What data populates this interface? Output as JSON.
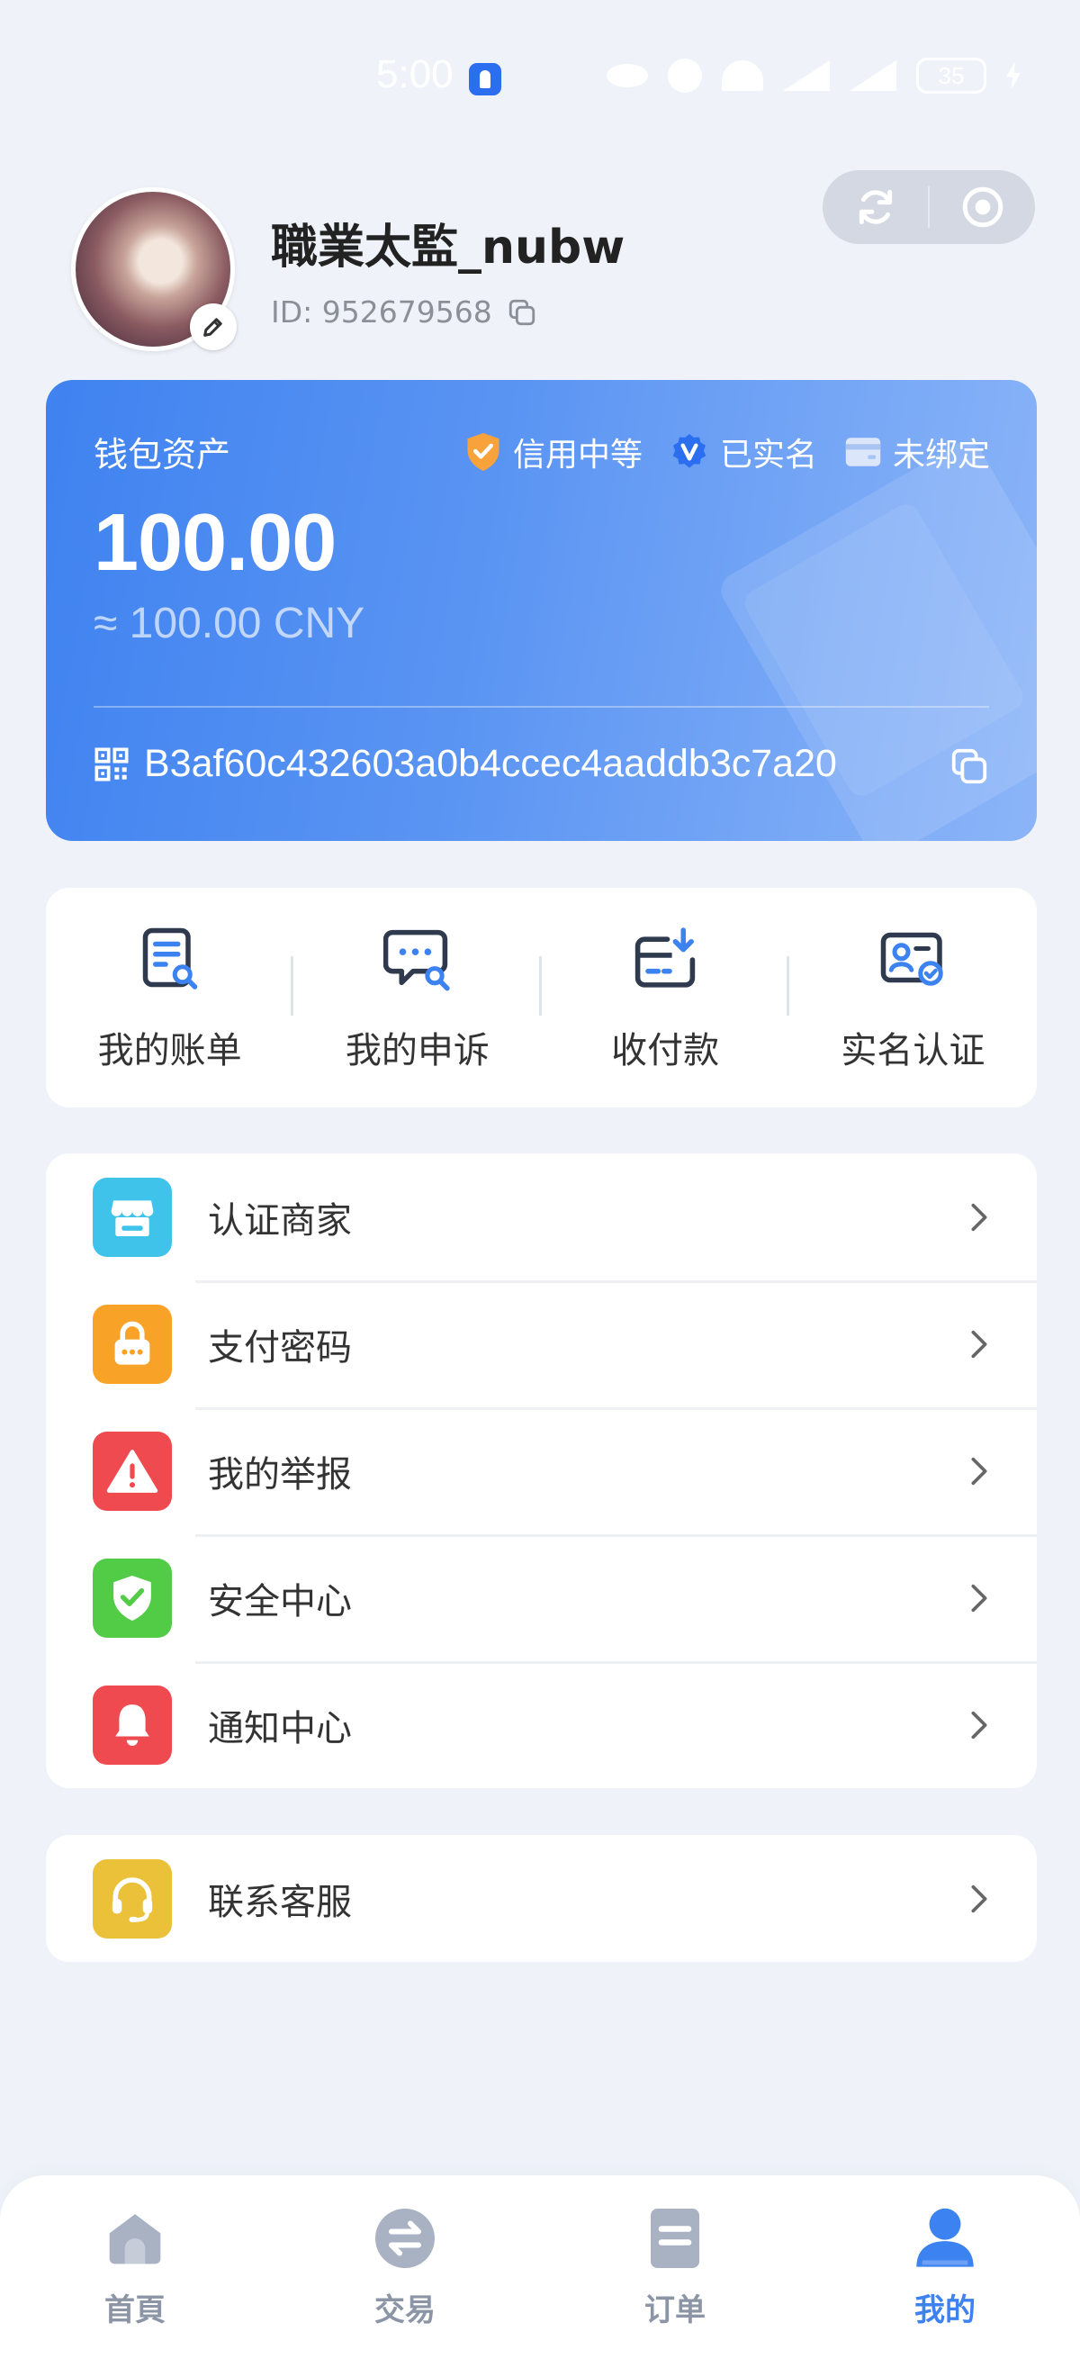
{
  "status_bar": {
    "time": "5:00",
    "battery": "35",
    "icons": [
      "notification-app-icon",
      "eye-icon",
      "alarm-icon",
      "wifi-icon",
      "5g-signal-icon",
      "4g-signal-icon",
      "battery-icon",
      "charging-icon"
    ]
  },
  "profile": {
    "username": "職業太監_nubw",
    "id_text": "ID: 952679568",
    "actions": [
      "refresh-icon",
      "record-icon"
    ]
  },
  "wallet": {
    "title": "钱包资产",
    "badges": [
      {
        "label": "信用中等",
        "icon": "shield-icon",
        "color": "#f7a23b"
      },
      {
        "label": "已实名",
        "icon": "verified-v-icon",
        "color": "#2b6ff0"
      },
      {
        "label": "未绑定",
        "icon": "card-icon",
        "color": "#dbe6fb"
      }
    ],
    "amount": "100.00",
    "sub_amount": "≈ 100.00 CNY",
    "address": "B3af60c432603a0b4ccec4aaddb3c7a20",
    "colors": {
      "start": "#3f82f0",
      "end": "#8cb5f8"
    }
  },
  "quick_actions": [
    {
      "label": "我的账单",
      "icon": "bill-search-icon"
    },
    {
      "label": "我的申诉",
      "icon": "appeal-chat-icon"
    },
    {
      "label": "收付款",
      "icon": "payment-card-icon"
    },
    {
      "label": "实名认证",
      "icon": "id-verify-icon"
    }
  ],
  "menu": [
    {
      "label": "认证商家",
      "icon": "store-icon",
      "color": "#3fc3ea"
    },
    {
      "label": "支付密码",
      "icon": "lock-icon",
      "color": "#f8a227"
    },
    {
      "label": "我的举报",
      "icon": "warning-icon",
      "color": "#ef4a4f"
    },
    {
      "label": "安全中心",
      "icon": "shield-check-icon",
      "color": "#52cc46"
    },
    {
      "label": "通知中心",
      "icon": "bell-icon",
      "color": "#ef4a4f"
    }
  ],
  "menu2": [
    {
      "label": "联系客服",
      "icon": "headset-icon",
      "color": "#ebc13a"
    }
  ],
  "bottom_nav": [
    {
      "label": "首頁",
      "icon": "home-icon",
      "active": false
    },
    {
      "label": "交易",
      "icon": "exchange-icon",
      "active": false
    },
    {
      "label": "订单",
      "icon": "orders-icon",
      "active": false
    },
    {
      "label": "我的",
      "icon": "user-icon",
      "active": true
    }
  ]
}
